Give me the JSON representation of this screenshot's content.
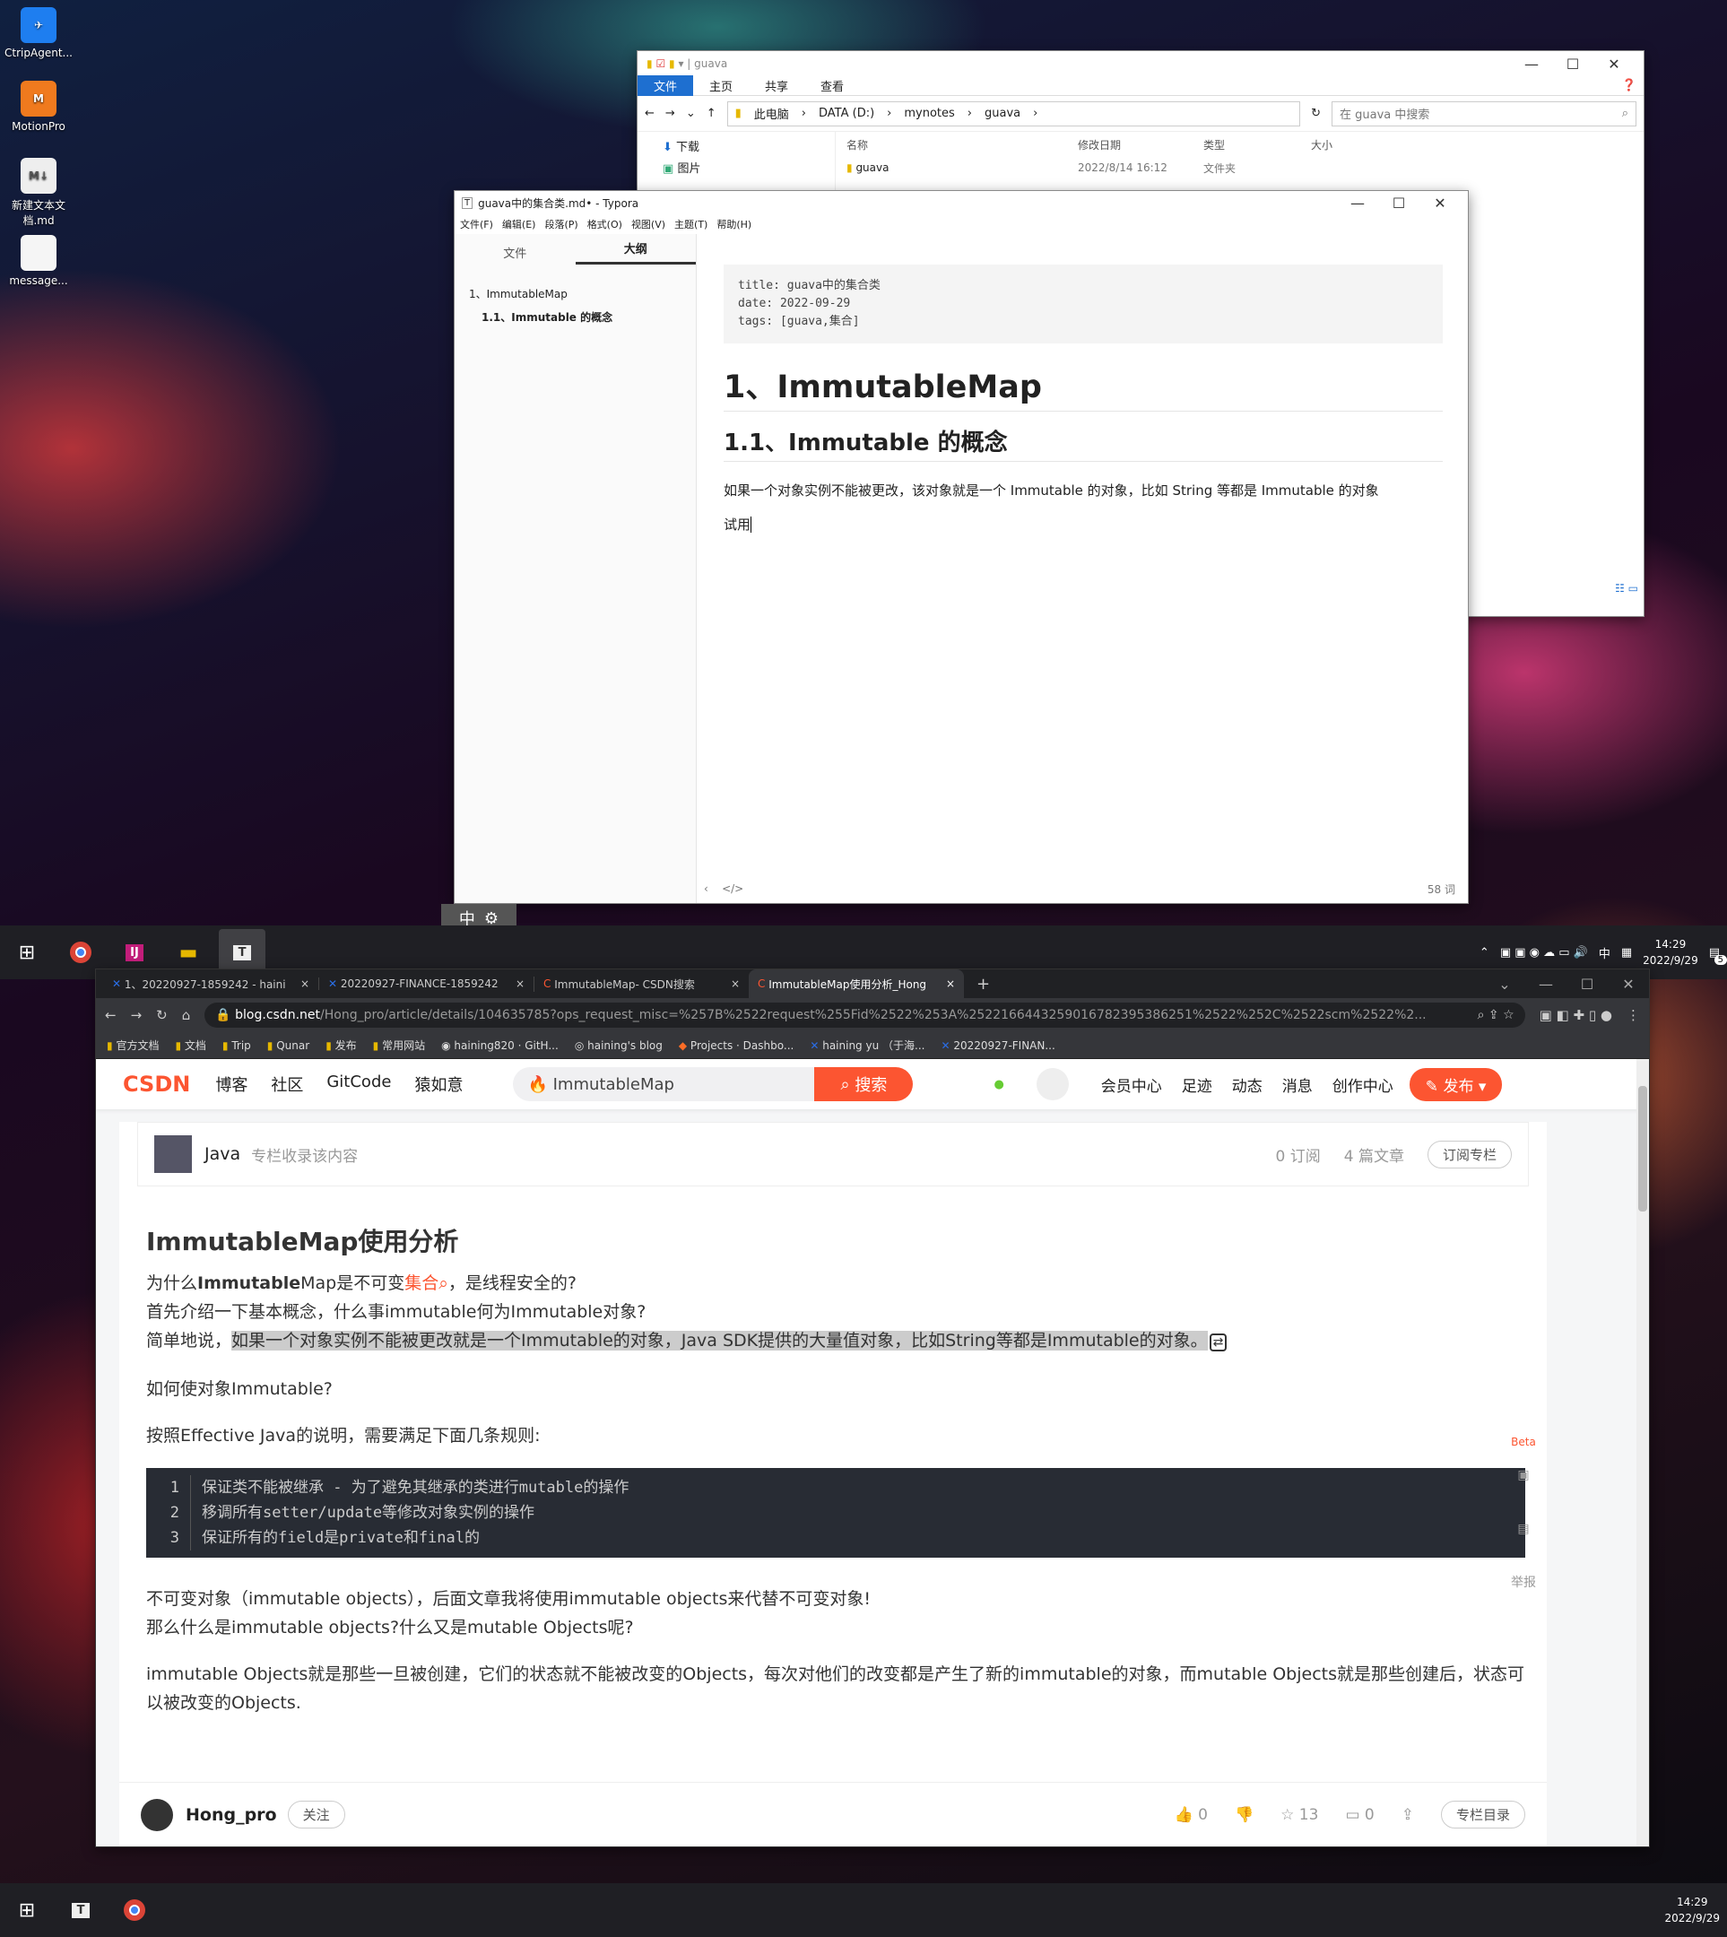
{
  "desktop": {
    "icons": [
      {
        "label": "CtripAgent..."
      },
      {
        "label": "MotionPro"
      },
      {
        "label": "新建文本文档.md"
      },
      {
        "label": "message..."
      }
    ]
  },
  "explorer": {
    "quick": "guava",
    "tabs": [
      "文件",
      "主页",
      "共享",
      "查看"
    ],
    "breadcrumb": [
      "此电脑",
      "DATA (D:)",
      "mynotes",
      "guava"
    ],
    "search_placeholder": "在 guava 中搜索",
    "nav": [
      "下载",
      "图片"
    ],
    "columns": [
      "名称",
      "修改日期",
      "类型",
      "大小"
    ],
    "row": {
      "name": "guava",
      "date": "2022/8/14 16:12",
      "type": "文件夹"
    }
  },
  "typora": {
    "title": "guava中的集合类.md• - Typora",
    "menu": [
      "文件(F)",
      "编辑(E)",
      "段落(P)",
      "格式(O)",
      "视图(V)",
      "主题(T)",
      "帮助(H)"
    ],
    "side_tabs": [
      "文件",
      "大纲"
    ],
    "outline": [
      "1、ImmutableMap",
      "1.1、Immutable 的概念"
    ],
    "front_matter": [
      "title: guava中的集合类",
      "date: 2022-09-29",
      "tags: [guava,集合]"
    ],
    "h1": "1、ImmutableMap",
    "h2": "1.1、Immutable 的概念",
    "para": "如果一个对象实例不能被更改，该对象就是一个 Immutable 的对象，比如 String 等都是 Immutable 的对象",
    "para2": "试用",
    "word_count": "58 词",
    "ime": "中"
  },
  "taskbar1": {
    "time": "14:29",
    "date": "2022/9/29",
    "ime": "中",
    "badge": "5"
  },
  "chrome": {
    "tabs": [
      "1、20220927-1859242 - haini",
      "20220927-FINANCE-1859242",
      "ImmutableMap- CSDN搜索",
      "ImmutableMap使用分析_Hong"
    ],
    "url_host": "blog.csdn.net",
    "url_path": "/Hong_pro/article/details/104635785?ops_request_misc=%257B%2522request%255Fid%2522%253A%2522166443259016782395386251%2522%252C%2522scm%2522%2...",
    "bookmarks": [
      "官方文档",
      "文档",
      "Trip",
      "Qunar",
      "发布",
      "常用网站",
      "haining820 · GitH...",
      "haining's blog",
      "Projects · Dashbo...",
      "haining yu （于海...",
      "20220927-FINAN..."
    ]
  },
  "csdn": {
    "logo": "CSDN",
    "nav": [
      "博客",
      "社区",
      "GitCode",
      "猿如意"
    ],
    "search": "ImmutableMap",
    "search_btn": "搜索",
    "user_nav": [
      "会员中心",
      "足迹",
      "动态",
      "消息",
      "创作中心"
    ],
    "publish": "发布",
    "column": {
      "name": "Java",
      "desc": "专栏收录该内容",
      "subs": "0 订阅",
      "articles": "4 篇文章",
      "btn": "订阅专栏"
    },
    "title": "ImmutableMap使用分析",
    "p1a": "为什么",
    "p1b": "Immutable",
    "p1c": "Map是不可变",
    "p1d": "集合",
    "p1e": "，是线程安全的?",
    "p2": "首先介绍一下基本概念，什么事immutable何为Immutable对象?",
    "p3a": "简单地说，",
    "p3b": "如果一个对象实例不能被更改就是一个Immutable的对象，Java SDK提供的大量值对象，比如String等都是Immutable的对象。",
    "p4": "如何使对象Immutable?",
    "p5": "按照Effective Java的说明，需要满足下面几条规则:",
    "code": [
      "保证类不能被继承 - 为了避免其继承的类进行mutable的操作",
      "移调所有setter/update等修改对象实例的操作",
      "保证所有的field是private和final的"
    ],
    "p6": "不可变对象（immutable objects），后面文章我将使用immutable objects来代替不可变对象!",
    "p7": "那么什么是immutable objects?什么又是mutable Objects呢?",
    "p8": "immutable Objects就是那些一旦被创建，它们的状态就不能被改变的Objects，每次对他们的改变都是产生了新的immutable的对象，而mutable Objects就是那些创建后，状态可以被改变的Objects.",
    "side": {
      "beta": "Beta",
      "report": "举报"
    },
    "author": "Hong_pro",
    "follow": "关注",
    "likes": "0",
    "stars": "13",
    "comments": "0",
    "toc": "专栏目录"
  },
  "taskbar2": {
    "time": "14:29",
    "date": "2022/9/29"
  }
}
